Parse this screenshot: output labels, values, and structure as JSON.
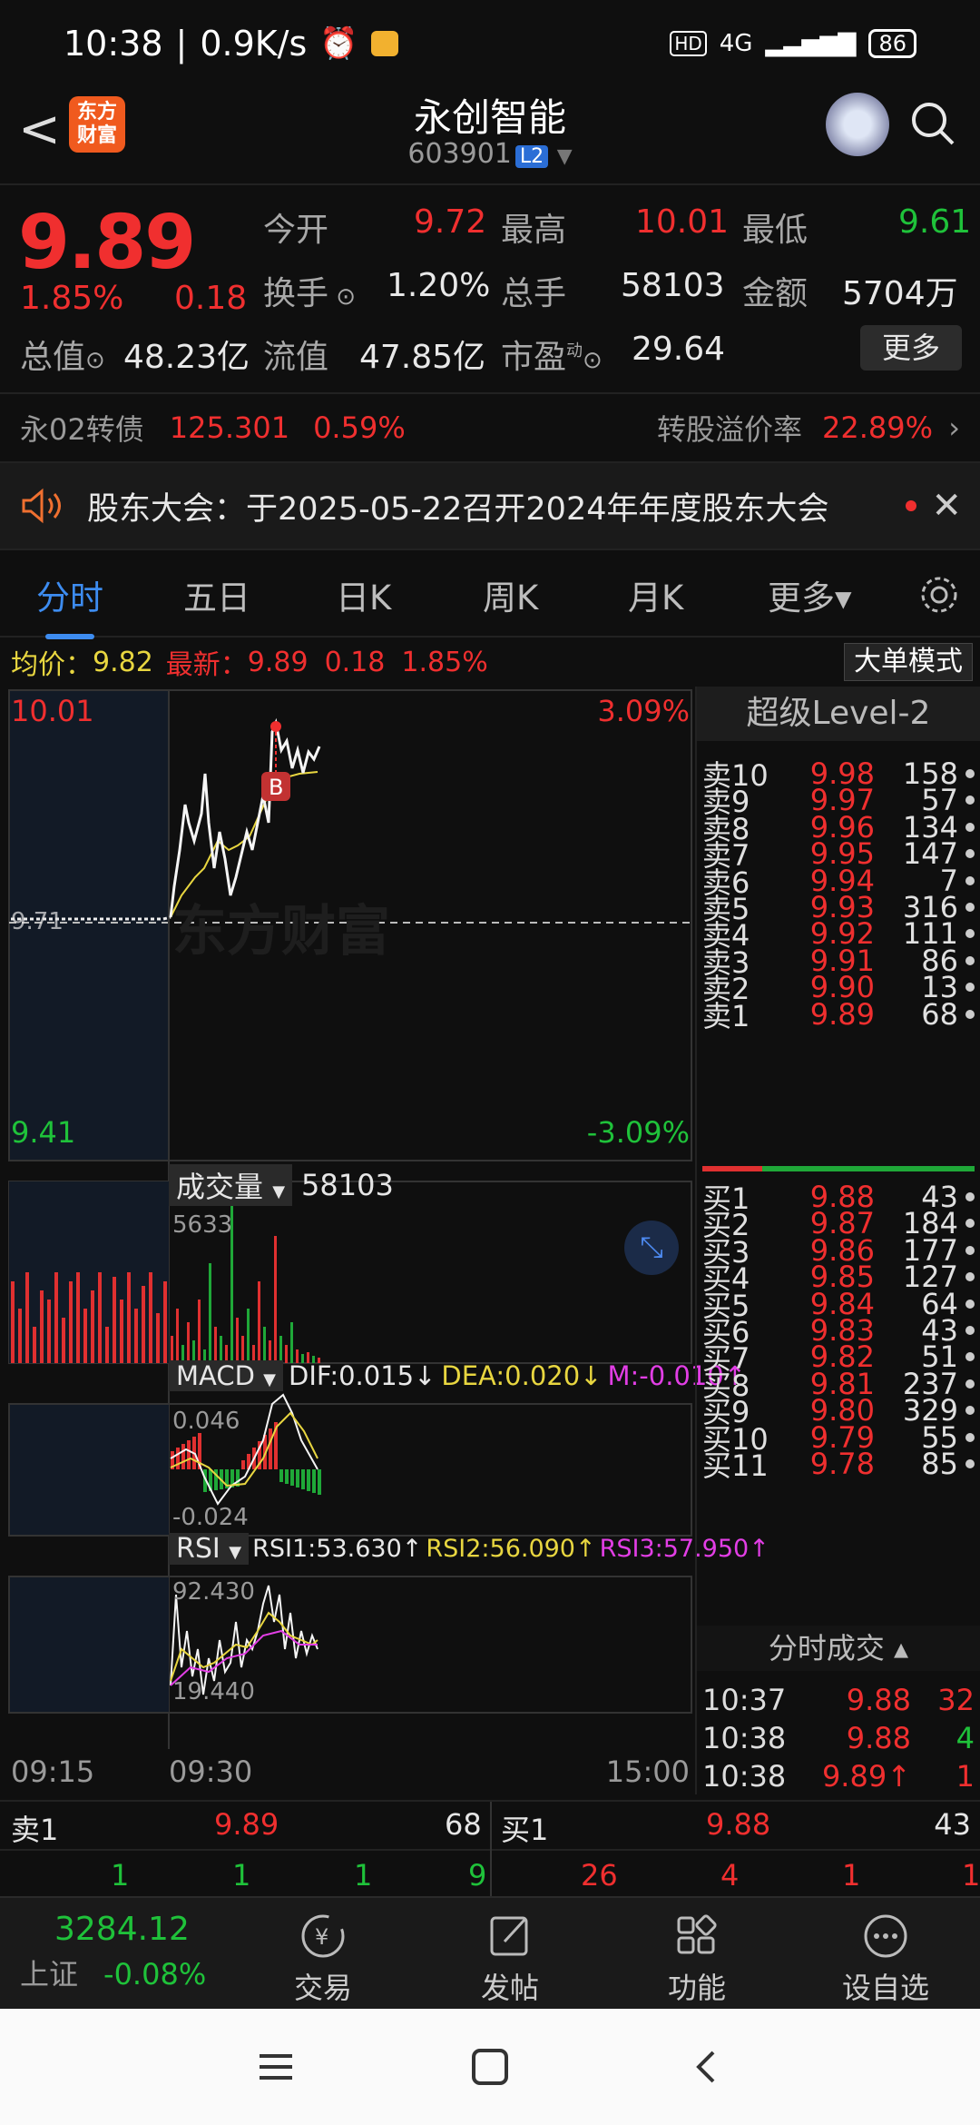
{
  "status": {
    "time": "10:38",
    "speed": "0.9K/s",
    "net": "4G",
    "battery": "86"
  },
  "header": {
    "back": "<",
    "logo": "东方\n财富",
    "title": "永创智能",
    "code": "603901",
    "l2": "L2"
  },
  "quote": {
    "price": "9.89",
    "pct": "1.85%",
    "chg": "0.18",
    "open_label": "今开",
    "open": "9.72",
    "high_label": "最高",
    "high": "10.01",
    "low_label": "最低",
    "low": "9.61",
    "turnover_label": "换手",
    "turnover": "1.20%",
    "vol_label": "总手",
    "vol": "58103",
    "amount_label": "金额",
    "amount": "5704万",
    "mcap_label": "总值",
    "mcap": "48.23亿",
    "float_label": "流值",
    "float": "47.85亿",
    "pe_label": "市盈",
    "pe_sup": "动",
    "pe": "29.64",
    "more": "更多"
  },
  "bond": {
    "name": "永02转债",
    "price": "125.301",
    "pct": "0.59%",
    "prem_label": "转股溢价率",
    "prem": "22.89%"
  },
  "notice": {
    "text": "股东大会：于2025-05-22召开2024年年度股东大会"
  },
  "tabs": [
    {
      "label": "分时"
    },
    {
      "label": "五日"
    },
    {
      "label": "日K"
    },
    {
      "label": "周K"
    },
    {
      "label": "月K"
    },
    {
      "label": "更多▾"
    }
  ],
  "avg": {
    "avg_label": "均价：",
    "avg": "9.82",
    "latest_label": "最新：",
    "latest": "9.89",
    "chg": "0.18",
    "pct": "1.85%",
    "big_mode": "大单模式"
  },
  "chart": {
    "top_price": "10.01",
    "top_pct": "3.09%",
    "bot_price": "9.41",
    "bot_pct": "-3.09%",
    "mid_price": "9.71",
    "watermark": "东方财富",
    "b_mark": "B",
    "vol_label": "成交量",
    "vol_value": "58103",
    "vol_max": "5633",
    "macd_label": "MACD",
    "dif": "DIF:0.015↓",
    "dea": "DEA:0.020↓",
    "m": "M:-0.010↑",
    "macd_max": "0.046",
    "macd_min": "-0.024",
    "rsi_label": "RSI",
    "rsi1": "RSI1:53.630↑",
    "rsi2": "RSI2:56.090↑",
    "rsi3": "RSI3:57.950↑",
    "rsi_max": "92.430",
    "rsi_min": "19.440",
    "t_start": "09:15",
    "t_mid": "09:30",
    "t_end": "15:00"
  },
  "orderbook": {
    "title": "超级Level-2",
    "sells": [
      {
        "n": "卖10",
        "p": "9.98",
        "v": "158"
      },
      {
        "n": "卖9",
        "p": "9.97",
        "v": "57"
      },
      {
        "n": "卖8",
        "p": "9.96",
        "v": "134"
      },
      {
        "n": "卖7",
        "p": "9.95",
        "v": "147"
      },
      {
        "n": "卖6",
        "p": "9.94",
        "v": "7"
      },
      {
        "n": "卖5",
        "p": "9.93",
        "v": "316"
      },
      {
        "n": "卖4",
        "p": "9.92",
        "v": "111"
      },
      {
        "n": "卖3",
        "p": "9.91",
        "v": "86"
      },
      {
        "n": "卖2",
        "p": "9.90",
        "v": "13"
      },
      {
        "n": "卖1",
        "p": "9.89",
        "v": "68"
      }
    ],
    "buys": [
      {
        "n": "买1",
        "p": "9.88",
        "v": "43"
      },
      {
        "n": "买2",
        "p": "9.87",
        "v": "184"
      },
      {
        "n": "买3",
        "p": "9.86",
        "v": "177"
      },
      {
        "n": "买4",
        "p": "9.85",
        "v": "127"
      },
      {
        "n": "买5",
        "p": "9.84",
        "v": "64"
      },
      {
        "n": "买6",
        "p": "9.83",
        "v": "43"
      },
      {
        "n": "买7",
        "p": "9.82",
        "v": "51"
      },
      {
        "n": "买8",
        "p": "9.81",
        "v": "237"
      },
      {
        "n": "买9",
        "p": "9.80",
        "v": "329"
      },
      {
        "n": "买10",
        "p": "9.79",
        "v": "55"
      },
      {
        "n": "买11",
        "p": "9.78",
        "v": "85"
      }
    ],
    "ticks_title": "分时成交 ▴",
    "ticks": [
      {
        "t": "10:37",
        "p": "9.88",
        "v": "32"
      },
      {
        "t": "10:38",
        "p": "9.88",
        "v": "4"
      },
      {
        "t": "10:38",
        "p": "9.89↑",
        "v": "1"
      }
    ]
  },
  "bottom": {
    "s1_label": "卖1",
    "s1_price": "9.89",
    "s1_vol": "68",
    "b1_label": "买1",
    "b1_price": "9.88",
    "b1_vol": "43",
    "left": [
      "1",
      "1",
      "1",
      "9"
    ],
    "right": [
      "26",
      "4",
      "1",
      "1"
    ]
  },
  "dock": {
    "index_value": "3284.12",
    "index_name": "上证",
    "index_pct": "-0.08%",
    "trade": "交易",
    "post": "发帖",
    "func": "功能",
    "watch": "设自选"
  }
}
